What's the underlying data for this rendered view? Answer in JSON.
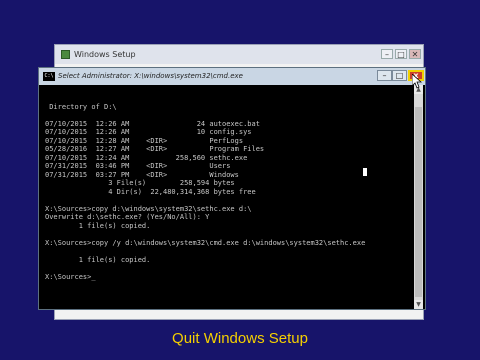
{
  "setup_window": {
    "title": "Windows Setup",
    "min_glyph": "–",
    "max_glyph": "□",
    "close_glyph": "✕"
  },
  "cmd_window": {
    "title": "Select Administrator: X:\\windows\\system32\\cmd.exe",
    "icon_text": "C:\\",
    "min_glyph": "–",
    "max_glyph": "□",
    "close_glyph": "x"
  },
  "console": {
    "text": "\n Directory of D:\\\n\n07/10/2015  12:26 AM                24 autoexec.bat\n07/10/2015  12:26 AM                10 config.sys\n07/10/2015  12:28 AM    <DIR>          PerfLogs\n05/28/2016  12:27 AM    <DIR>          Program Files\n07/10/2015  12:24 AM           258,560 sethc.exe\n07/31/2015  03:46 PM    <DIR>          Users\n07/31/2015  03:27 PM    <DIR>          Windows\n               3 File(s)        258,594 bytes\n               4 Dir(s)  22,480,314,368 bytes free\n\nX:\\Sources>copy d:\\windows\\system32\\sethc.exe d:\\\nOverwrite d:\\sethc.exe? (Yes/No/All): Y\n        1 file(s) copied.\n\nX:\\Sources>copy /y d:\\windows\\system32\\cmd.exe d:\\windows\\system32\\sethc.exe\n\n        1 file(s) copied.\n\nX:\\Sources>_"
  },
  "scrollbar": {
    "up_glyph": "▲",
    "down_glyph": "▼"
  },
  "caption": "Quit Windows Setup",
  "colors": {
    "background": "#17146a",
    "caption": "#f5d000",
    "close_highlight": "#f0d000"
  }
}
